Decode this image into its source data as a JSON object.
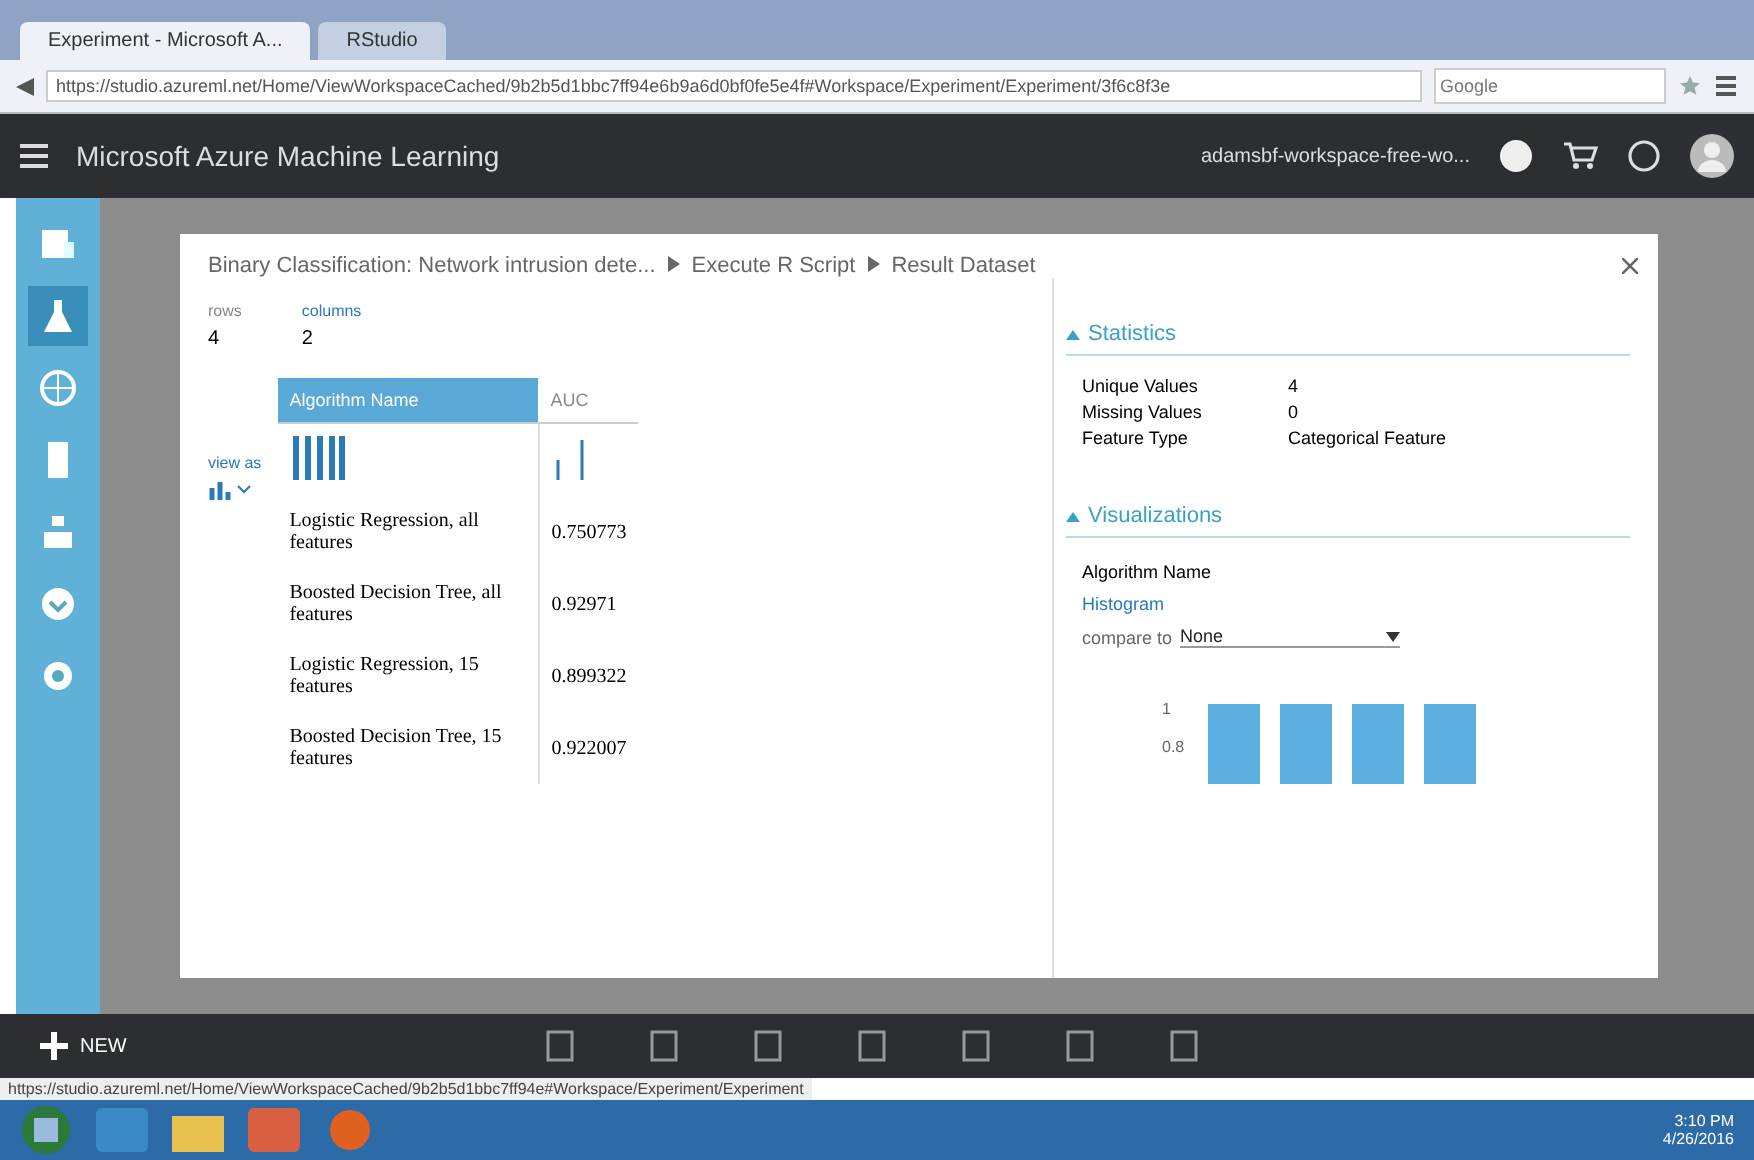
{
  "browser": {
    "tabs": [
      {
        "label": "Experiment - Microsoft A...",
        "selected": true
      },
      {
        "label": "RStudio",
        "selected": false
      }
    ],
    "address": "https://studio.azureml.net/Home/ViewWorkspaceCached/9b2b5d1bbc7ff94e6b9a6d0bf0fe5e4f#Workspace/Experiment/Experiment/3f6c8f3e",
    "search_placeholder": "Google"
  },
  "header": {
    "title": "Microsoft Azure Machine Learning",
    "workspace": "adamsbf-workspace-free-wo..."
  },
  "sidebar": [
    {
      "selected": false
    },
    {
      "selected": true
    },
    {
      "selected": false
    },
    {
      "selected": false
    },
    {
      "selected": false
    },
    {
      "selected": false
    },
    {
      "selected": false
    }
  ],
  "modal": {
    "breadcrumb": [
      "Binary Classification: Network intrusion dete...",
      "Execute R Script",
      "Result Dataset"
    ],
    "summary": [
      {
        "label": "rows",
        "value": "4"
      },
      {
        "label": "columns",
        "value": "2"
      }
    ],
    "view_as": "view as",
    "columns": [
      {
        "name": "Algorithm Name",
        "selected": true
      },
      {
        "name": "AUC",
        "selected": false
      }
    ],
    "rows": [
      [
        "Logistic Regression, all features",
        "0.750773"
      ],
      [
        "Boosted Decision Tree, all features",
        "0.92971"
      ],
      [
        "Logistic Regression, 15 features",
        "0.899322"
      ],
      [
        "Boosted Decision Tree, 15 features",
        "0.922007"
      ]
    ],
    "statistics": {
      "title": "Statistics",
      "expanded": true,
      "items": [
        {
          "label": "Unique Values",
          "value": "4"
        },
        {
          "label": "Missing Values",
          "value": "0"
        },
        {
          "label": "Feature Type",
          "value": "Categorical Feature"
        }
      ]
    },
    "visualizations": {
      "title": "Visualizations",
      "expanded": true,
      "column": "Algorithm Name",
      "chart_kind": "Histogram",
      "compare_label": "compare to",
      "compare_value": "None",
      "axis_labels": [
        "1",
        "0.8"
      ]
    }
  },
  "toolbar": {
    "new": "NEW"
  },
  "status_url": "https://studio.azureml.net/Home/ViewWorkspaceCached/9b2b5d1bbc7ff94e#Workspace/Experiment/Experiment",
  "taskbar": {
    "time": "3:10 PM",
    "date": "4/26/2016"
  }
}
